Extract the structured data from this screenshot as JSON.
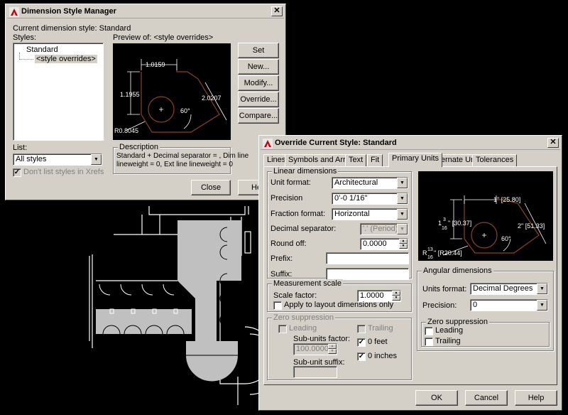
{
  "dsm": {
    "title": "Dimension Style Manager",
    "current_style_label": "Current dimension style: Standard",
    "styles_label": "Styles:",
    "styles": [
      "Standard",
      "<style overrides>"
    ],
    "preview_label": "Preview of: <style overrides>",
    "buttons": [
      "Set Current",
      "New...",
      "Modify...",
      "Override...",
      "Compare..."
    ],
    "preview": {
      "dim_top": "1.0159",
      "dim_left": "1.1955",
      "dim_right": "2.0207",
      "angle": "60°",
      "radius": "R0.8045"
    },
    "list_label": "List:",
    "list_value": "All styles",
    "dont_list_label": "Don't list styles in Xrefs",
    "description_label": "Description",
    "description_text_1": "Standard + Decimal separator = , Dim line",
    "description_text_2": "lineweight = 0, Ext line lineweight = 0",
    "close_button": "Close",
    "help_button": "He"
  },
  "ocs": {
    "title": "Override Current Style: Standard",
    "tabs": [
      "Lines",
      "Symbols and Arrows",
      "Text",
      "Fit",
      "Primary Units",
      "Alternate Units",
      "Tolerances"
    ],
    "active_tab": "Primary Units",
    "linear": {
      "group_label": "Linear dimensions",
      "unit_format_label": "Unit format:",
      "unit_format_value": "Architectural",
      "precision_label": "Precision",
      "precision_value": "0'-0 1/16\"",
      "fraction_format_label": "Fraction format:",
      "fraction_format_value": "Horizontal",
      "decimal_separator_label": "Decimal separator:",
      "decimal_separator_value": "'.' (Period)",
      "round_off_label": "Round off:",
      "round_off_value": "0.0000",
      "prefix_label": "Prefix:",
      "suffix_label": "Suffix:"
    },
    "measurement": {
      "group_label": "Measurement scale",
      "scale_factor_label": "Scale factor:",
      "scale_factor_value": "1.0000",
      "apply_layout_label": "Apply to layout dimensions only"
    },
    "zero_left": {
      "group_label": "Zero suppression",
      "leading_label": "Leading",
      "trailing_label": "Trailing",
      "sub_units_factor_label": "Sub-units factor:",
      "sub_units_factor_value": "100.0000",
      "sub_unit_suffix_label": "Sub-unit suffix:",
      "feet_label": "0 feet",
      "inches_label": "0 inches"
    },
    "preview": {
      "dim_top": "1\" [25.80]",
      "dim_left_whole": "1",
      "dim_left_num": "3",
      "dim_left_den": "16",
      "dim_left_rest": "\" [30.37]",
      "dim_right": "2\" [51.33]",
      "angle": "60°",
      "radius_prefix": "R",
      "radius_num": "13",
      "radius_den": "16",
      "radius_rest": "\" [R20.44]"
    },
    "angular": {
      "group_label": "Angular dimensions",
      "units_format_label": "Units format:",
      "units_format_value": "Decimal Degrees",
      "precision_label": "Precision:",
      "precision_value": "0",
      "zero_group_label": "Zero suppression",
      "leading_label": "Leading",
      "trailing_label": "Trailing"
    },
    "ok_button": "OK",
    "cancel_button": "Cancel",
    "help_button": "Help"
  },
  "colors": {
    "dialog_bg": "#d4d0c8",
    "drawing_gray": "#c0c0c0",
    "preview_line": "#8b4513"
  }
}
